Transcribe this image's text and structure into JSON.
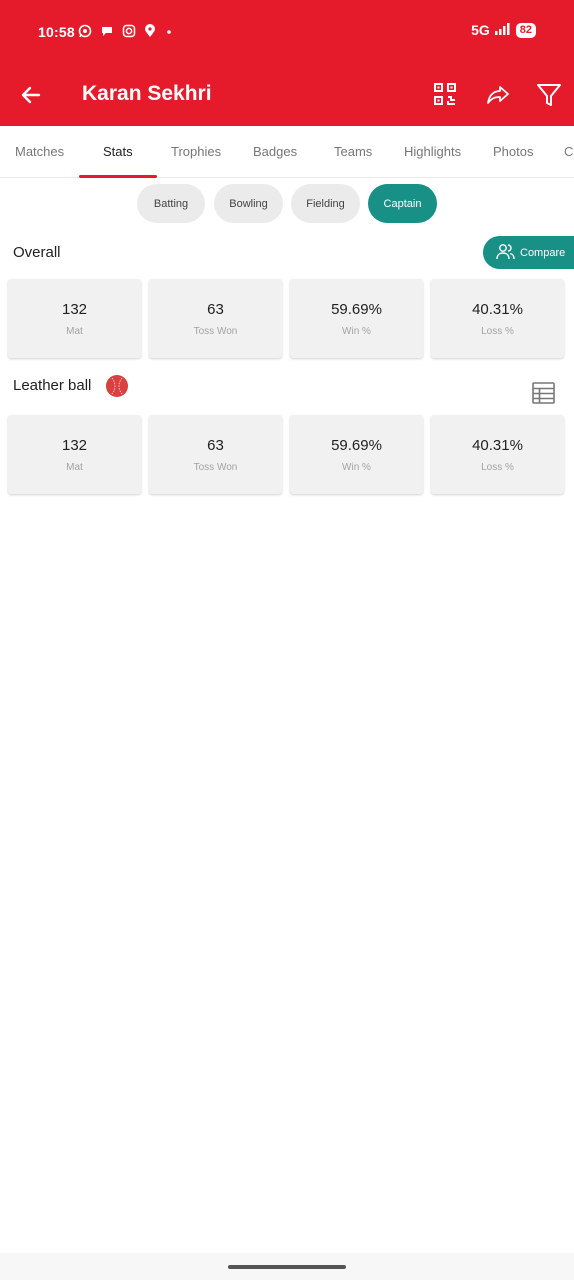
{
  "status_bar": {
    "time": "10:58",
    "network": "5G",
    "battery": "82",
    "icons": [
      "whatsapp-icon",
      "message-icon",
      "instagram-icon",
      "location-icon",
      "dot-icon"
    ]
  },
  "appbar": {
    "title": "Karan Sekhri",
    "actions": [
      "qr-code-icon",
      "share-icon",
      "filter-icon"
    ]
  },
  "tabs": [
    {
      "label": "Matches",
      "active": false
    },
    {
      "label": "Stats",
      "active": true
    },
    {
      "label": "Trophies",
      "active": false
    },
    {
      "label": "Badges",
      "active": false
    },
    {
      "label": "Teams",
      "active": false
    },
    {
      "label": "Highlights",
      "active": false
    },
    {
      "label": "Photos",
      "active": false
    },
    {
      "label": "Co",
      "active": false
    }
  ],
  "chips": [
    {
      "label": "Batting",
      "active": false
    },
    {
      "label": "Bowling",
      "active": false
    },
    {
      "label": "Fielding",
      "active": false
    },
    {
      "label": "Captain",
      "active": true
    }
  ],
  "overall": {
    "title": "Overall",
    "compare_label": "Compare",
    "stats": [
      {
        "value": "132",
        "label": "Mat"
      },
      {
        "value": "63",
        "label": "Toss Won"
      },
      {
        "value": "59.69%",
        "label": "Win %"
      },
      {
        "value": "40.31%",
        "label": "Loss %"
      }
    ]
  },
  "leather": {
    "title": "Leather ball",
    "stats": [
      {
        "value": "132",
        "label": "Mat"
      },
      {
        "value": "63",
        "label": "Toss Won"
      },
      {
        "value": "59.69%",
        "label": "Win %"
      },
      {
        "value": "40.31%",
        "label": "Loss %"
      }
    ]
  },
  "colors": {
    "brand_red": "#e51b2b",
    "accent_teal": "#189086"
  }
}
